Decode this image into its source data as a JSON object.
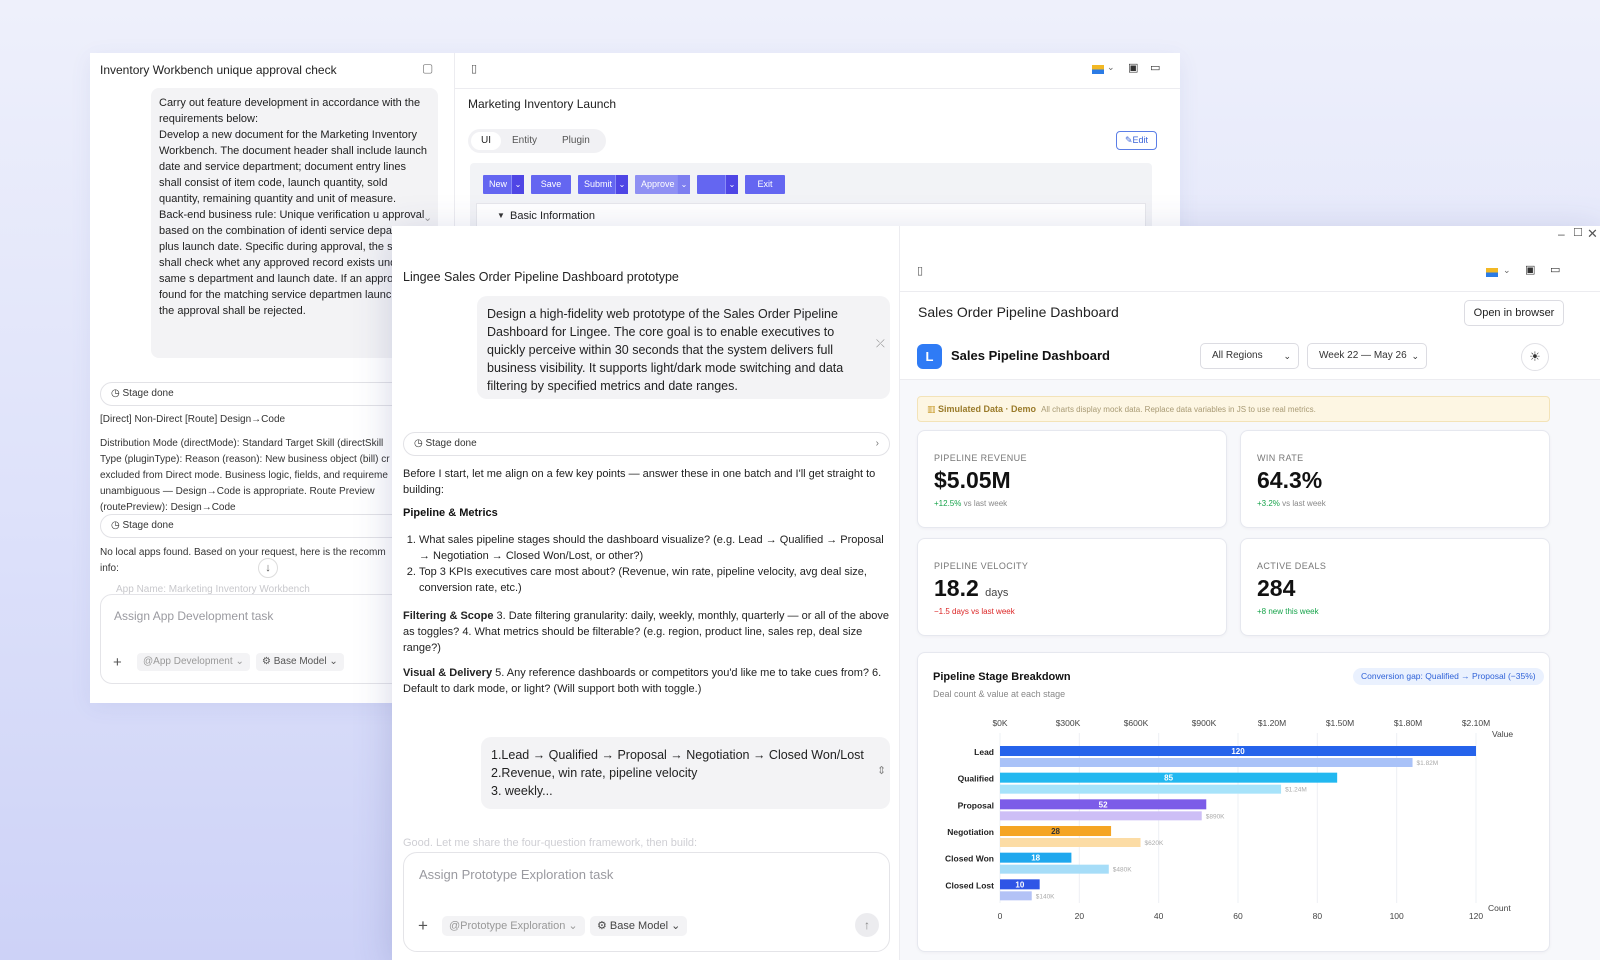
{
  "w1": {
    "title": "Inventory Workbench unique approval check",
    "user_message": "Carry out feature development in accordance with the requirements below:\nDevelop a new document for the Marketing Inventory Workbench. The document header shall include launch date and service department; document entry lines shall consist of item code, launch quantity, sold quantity, remaining quantity and unit of measure.\nBack-end business rule: Unique verification u approval based on the combination of identi service department plus launch date. Specific during approval, the system shall check whet any approved record exists under the same s department and launch date. If an approved is found for the matching service departmen launch date, the approval shall be rejected.",
    "stage1": "Stage done",
    "route_line": "[Direct] Non-Direct [Route] Design→Code",
    "route_detail": "Distribution Mode (directMode): Standard Target Skill (directSkill Type (pluginType): Reason (reason): New business object (bill) cr excluded from Direct mode. Business logic, fields, and requireme unambiguous — Design→Code is appropriate. Route Preview (routePreview): Design→Code",
    "stage2": "Stage done",
    "no_apps": "No local apps found. Based on your request, here is the recomm info:",
    "faded": "App Name: Marketing Inventory Workbench",
    "input_placeholder": "Assign App Development task",
    "chip1": "@App Development",
    "chip2": "Base Model",
    "preview_title": "Marketing Inventory Launch",
    "tabs": [
      "UI",
      "Entity",
      "Plugin"
    ],
    "edit": "Edit",
    "toolbar": {
      "new": "New",
      "save": "Save",
      "submit": "Submit",
      "approve": "Approve",
      "exit": "Exit"
    },
    "section": "Basic Information"
  },
  "w2": {
    "title": "Lingee Sales Order Pipeline Dashboard prototype",
    "user_message": "Design a high-fidelity web prototype of the Sales Order Pipeline Dashboard for Lingee. The core goal is to enable executives to quickly perceive within 30 seconds that the system delivers full business visibility. It supports light/dark mode switching and data filtering by specified metrics and date ranges.",
    "stage": "Stage done",
    "intro": "Before I start, let me align on a few key points — answer these in one batch and I'll get straight to building:",
    "h_pipeline": "Pipeline & Metrics",
    "q1": "What sales pipeline stages should the dashboard visualize? (e.g. Lead → Qualified → Proposal → Negotiation → Closed Won/Lost, or other?)",
    "q2": "Top 3 KPIs executives care most about? (Revenue, win rate, pipeline velocity, avg deal size, conversion rate, etc.)",
    "h_filter": "Filtering & Scope",
    "filter_text": " 3. Date filtering granularity: daily, weekly, monthly, quarterly — or all of the above as toggles? 4. What metrics should be filterable? (e.g. region, product line, sales rep, deal size range?)",
    "h_visual": "Visual & Delivery",
    "visual_text": " 5. Any reference dashboards or competitors you'd like me to take cues from? 6. Default to dark mode, or light? (Will support both with toggle.)",
    "reply1": "1.Lead → Qualified → Proposal → Negotiation → Closed Won/Lost",
    "reply2": "2.Revenue, win rate, pipeline velocity",
    "reply3": "3. weekly...",
    "faded": "Good. Let me share the four-question framework, then build:",
    "input_placeholder": "Assign Prototype Exploration task",
    "chip1": "@Prototype Exploration",
    "chip2": "Base Model",
    "preview_title": "Sales Order Pipeline Dashboard",
    "open_browser": "Open in browser"
  },
  "dash": {
    "logo": "L",
    "title": "Sales Pipeline Dashboard",
    "region": "All Regions",
    "week": "Week 22 — May 26",
    "banner_strong": "Simulated Data · Demo",
    "banner_text": "All charts display mock data. Replace data variables in JS to use real metrics.",
    "kpis": [
      {
        "label": "PIPELINE REVENUE",
        "value": "$5.05M",
        "unit": "",
        "delta": "+12.5%",
        "delta_note": "vs last week",
        "dir": "up"
      },
      {
        "label": "WIN RATE",
        "value": "64.3%",
        "unit": "",
        "delta": "+3.2%",
        "delta_note": "vs last week",
        "dir": "up"
      },
      {
        "label": "PIPELINE VELOCITY",
        "value": "18.2",
        "unit": "days",
        "delta": "−1.5",
        "delta_note": "days vs last week",
        "dir": "down"
      },
      {
        "label": "ACTIVE DEALS",
        "value": "284",
        "unit": "",
        "delta": "+8",
        "delta_note": "new this week",
        "dir": "up"
      }
    ],
    "chart_title": "Pipeline Stage Breakdown",
    "chart_subtitle": "Deal count & value at each stage",
    "chart_badge": "Conversion gap: Qualified → Proposal (−35%)",
    "colors": {
      "accent": "#6466f1",
      "lead": "#2563eb",
      "qualified": "#22b8f0",
      "proposal": "#7c5ce8",
      "negotiation": "#f5a524",
      "won": "#1fa8ee",
      "lost": "#2f55e6"
    }
  },
  "chart_data": {
    "type": "bar",
    "title": "Pipeline Stage Breakdown",
    "subtitle": "Deal count & value at each stage",
    "categories": [
      "Lead",
      "Qualified",
      "Proposal",
      "Negotiation",
      "Closed Won",
      "Closed Lost"
    ],
    "series": [
      {
        "name": "Count",
        "values": [
          120,
          85,
          52,
          28,
          18,
          10
        ]
      },
      {
        "name": "Value",
        "values": [
          1.82,
          1.24,
          0.89,
          0.62,
          0.48,
          0.14
        ]
      }
    ],
    "value_labels": [
      "$1.82M",
      "$1.24M",
      "$890K",
      "$620K",
      "$480K",
      "$140K"
    ],
    "xlabel": "Count",
    "x2label": "Value",
    "xlim": [
      0,
      120
    ],
    "x2lim": [
      0,
      2.1
    ],
    "xticks": [
      "0",
      "20",
      "40",
      "60",
      "80",
      "100",
      "120"
    ],
    "x2ticks": [
      "$0K",
      "$300K",
      "$600K",
      "$900K",
      "$1.20M",
      "$1.50M",
      "$1.80M",
      "$2.10M"
    ],
    "colors": [
      "#2563eb",
      "#22b8f0",
      "#7c5ce8",
      "#f5a524",
      "#1fa8ee",
      "#2f55e6"
    ],
    "light_colors": [
      "#a9c2f8",
      "#a7e3fa",
      "#cdbef6",
      "#fcdca5",
      "#a6ddf8",
      "#b3c2f6"
    ],
    "grid": true
  }
}
